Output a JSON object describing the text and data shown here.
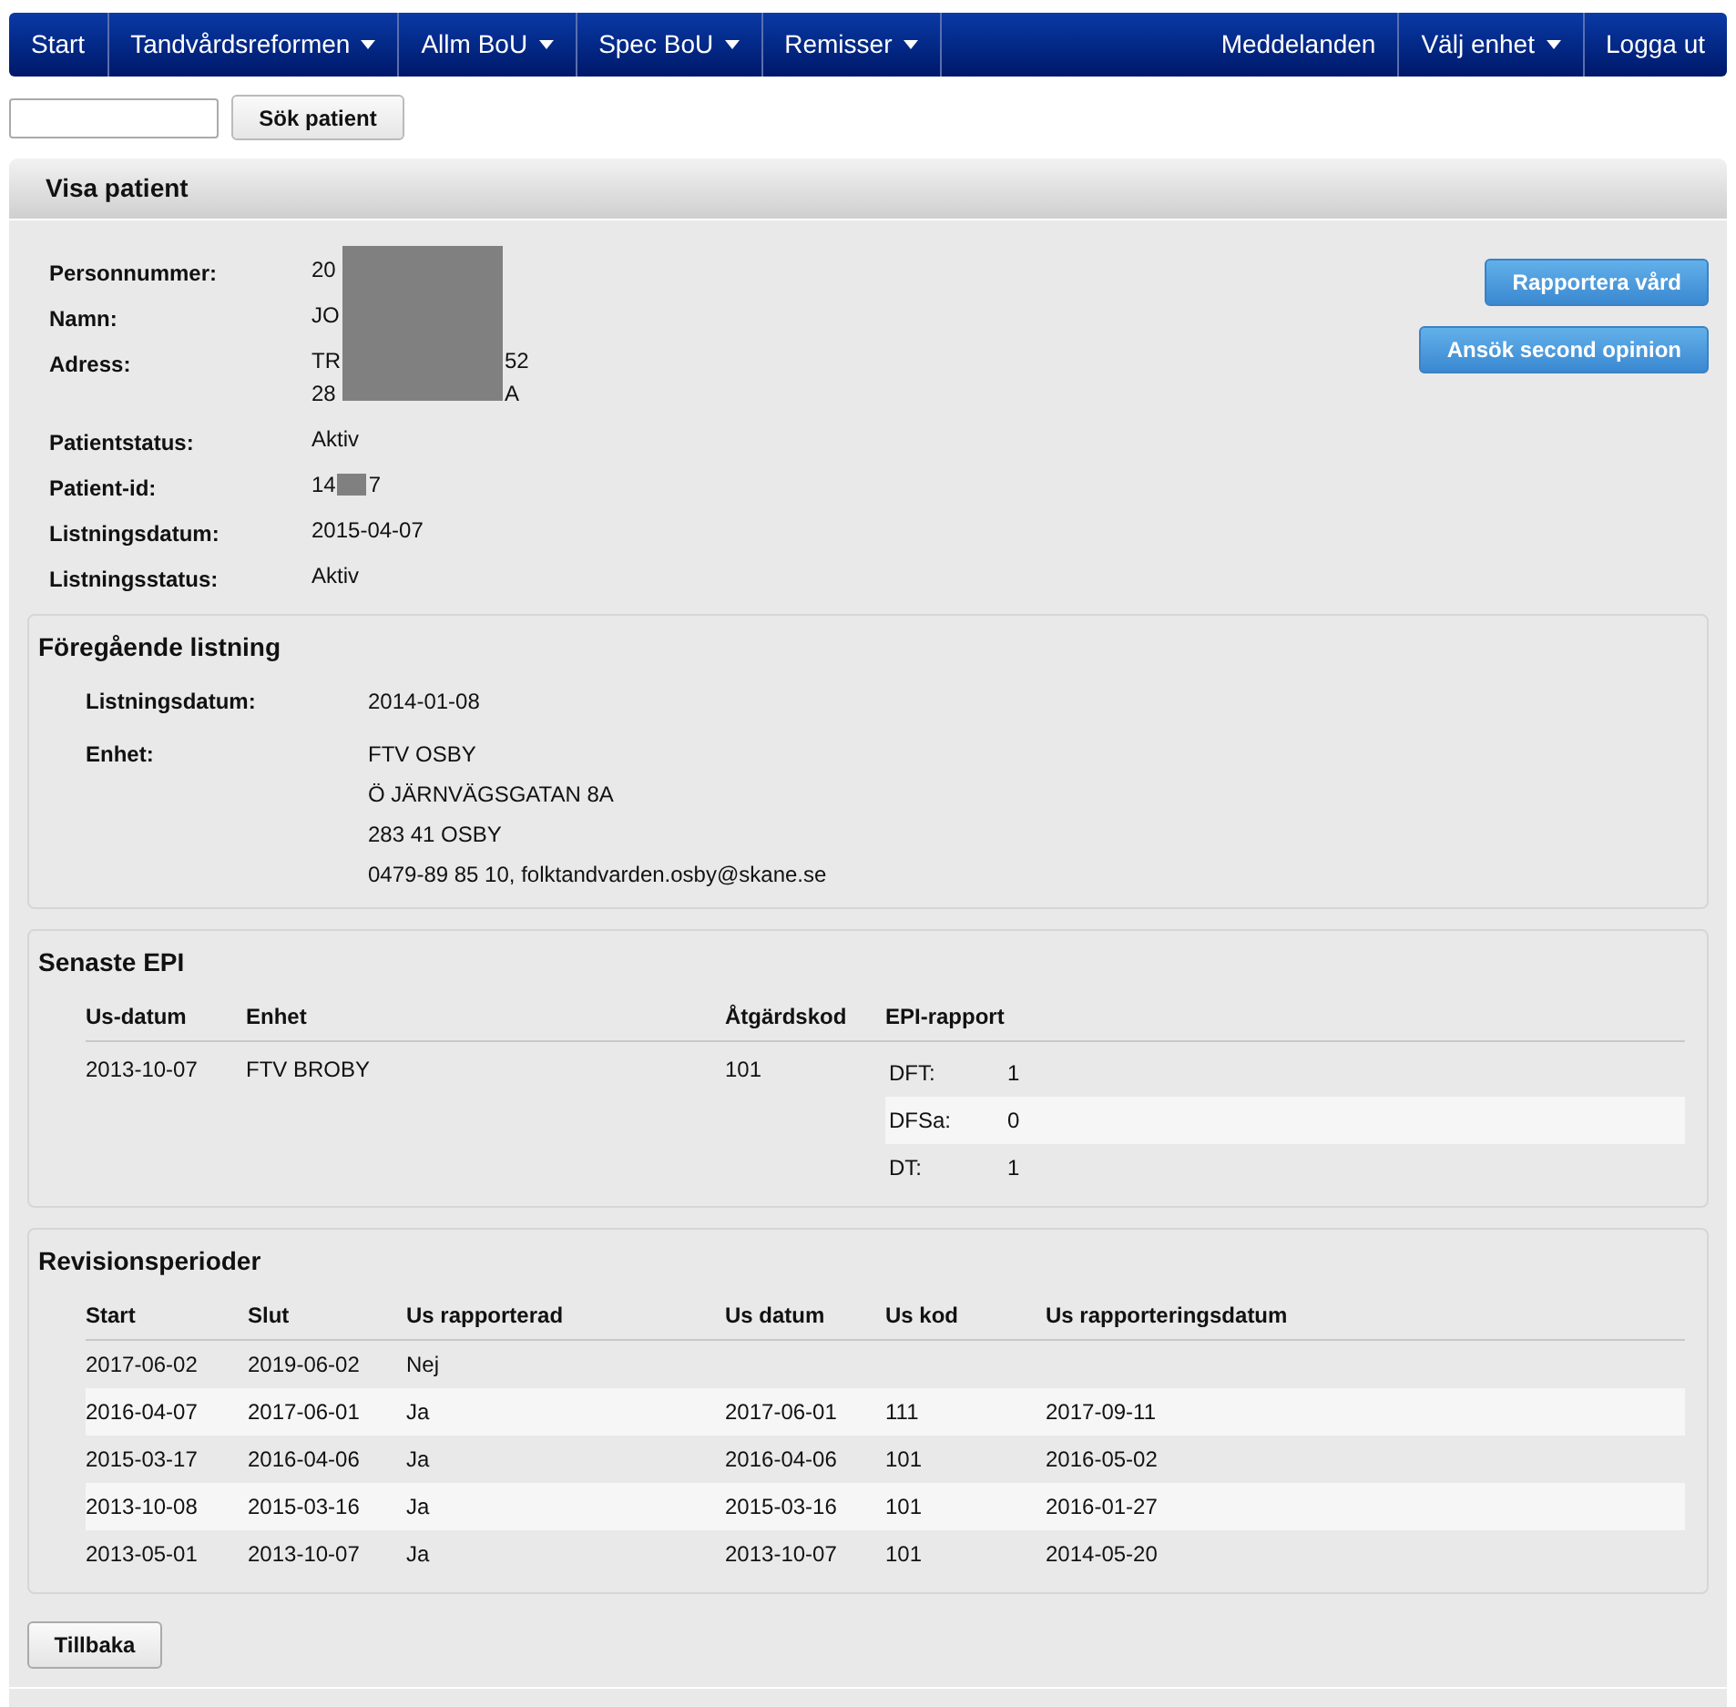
{
  "nav": {
    "left": [
      {
        "label": "Start",
        "dropdown": false
      },
      {
        "label": "Tandvårdsreformen",
        "dropdown": true
      },
      {
        "label": "Allm BoU",
        "dropdown": true
      },
      {
        "label": "Spec BoU",
        "dropdown": true
      },
      {
        "label": "Remisser",
        "dropdown": true
      }
    ],
    "right": [
      {
        "label": "Meddelanden",
        "dropdown": false
      },
      {
        "label": "Välj enhet",
        "dropdown": true
      },
      {
        "label": "Logga ut",
        "dropdown": false
      }
    ]
  },
  "search": {
    "button": "Sök patient"
  },
  "panel": {
    "title": "Visa patient",
    "actions": [
      "Rapportera vård",
      "Ansök second opinion"
    ],
    "details": [
      {
        "label": "Personnummer:",
        "kind": "covered",
        "lines": [
          [
            "20"
          ]
        ]
      },
      {
        "label": "Namn:",
        "kind": "covered",
        "lines": [
          [
            "JO"
          ]
        ]
      },
      {
        "label": "Adress:",
        "kind": "covered",
        "lines": [
          [
            "TR",
            "52"
          ],
          [
            "28",
            "A"
          ]
        ]
      },
      {
        "label": "Patientstatus:",
        "kind": "plain",
        "lines": [
          [
            "Aktiv"
          ]
        ]
      },
      {
        "label": "Patient-id:",
        "kind": "masked",
        "lines": [
          [
            "14",
            "7"
          ]
        ]
      },
      {
        "label": "Listningsdatum:",
        "kind": "plain",
        "lines": [
          [
            "2015-04-07"
          ]
        ]
      },
      {
        "label": "Listningsstatus:",
        "kind": "plain",
        "lines": [
          [
            "Aktiv"
          ]
        ]
      }
    ],
    "previous": {
      "title": "Föregående listning",
      "rows": [
        {
          "label": "Listningsdatum:",
          "lines": [
            "2014-01-08"
          ]
        },
        {
          "label": "Enhet:",
          "lines": [
            "FTV OSBY",
            "Ö JÄRNVÄGSGATAN 8A",
            "283 41 OSBY",
            "0479-89 85 10, folktandvarden.osby@skane.se"
          ]
        }
      ]
    },
    "epi": {
      "title": "Senaste EPI",
      "columns": [
        "Us-datum",
        "Enhet",
        "Åtgärdskod",
        "EPI-rapport"
      ],
      "rows": [
        {
          "date": "2013-10-07",
          "unit": "FTV BROBY",
          "code": "101",
          "report": [
            {
              "label": "DFT:",
              "value": "1"
            },
            {
              "label": "DFSa:",
              "value": "0"
            },
            {
              "label": "DT:",
              "value": "1"
            }
          ]
        }
      ]
    },
    "revision": {
      "title": "Revisionsperioder",
      "columns": [
        "Start",
        "Slut",
        "Us rapporterad",
        "Us datum",
        "Us kod",
        "Us rapporteringsdatum"
      ],
      "rows": [
        [
          "2017-06-02",
          "2019-06-02",
          "Nej",
          "",
          "",
          ""
        ],
        [
          "2016-04-07",
          "2017-06-01",
          "Ja",
          "2017-06-01",
          "111",
          "2017-09-11"
        ],
        [
          "2015-03-17",
          "2016-04-06",
          "Ja",
          "2016-04-06",
          "101",
          "2016-05-02"
        ],
        [
          "2013-10-08",
          "2015-03-16",
          "Ja",
          "2015-03-16",
          "101",
          "2016-01-27"
        ],
        [
          "2013-05-01",
          "2013-10-07",
          "Ja",
          "2013-10-07",
          "101",
          "2014-05-20"
        ]
      ]
    },
    "back": "Tillbaka"
  }
}
